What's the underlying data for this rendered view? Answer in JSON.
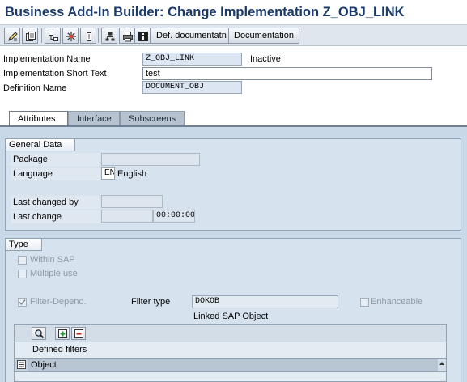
{
  "window": {
    "title": "Business Add-In Builder: Change Implementation Z_OBJ_LINK"
  },
  "toolbar": {
    "icons": [
      "edit-display-icon",
      "other-object-icon",
      "object-tree-icon",
      "activate-icon",
      "where-used-icon",
      "hierarchy-icon",
      "print-icon",
      "info-icon"
    ],
    "def_documentation_label": "Def. documentatn",
    "documentation_label": "Documentation"
  },
  "header": {
    "implementation_name": {
      "label": "Implementation Name",
      "value": "Z_OBJ_LINK",
      "status": "Inactive"
    },
    "short_text": {
      "label": "Implementation Short Text",
      "value": "test"
    },
    "definition_name": {
      "label": "Definition Name",
      "value": "DOCUMENT_OBJ"
    }
  },
  "tabs": [
    {
      "label": "Attributes",
      "active": true
    },
    {
      "label": "Interface",
      "active": false
    },
    {
      "label": "Subscreens",
      "active": false
    }
  ],
  "general_data": {
    "title": "General Data",
    "package": {
      "label": "Package",
      "value": ""
    },
    "language": {
      "label": "Language",
      "code": "EN",
      "name": "English"
    },
    "last_changed_by": {
      "label": "Last changed by",
      "value": ""
    },
    "last_change": {
      "label": "Last change",
      "date": "",
      "time": "00:00:00"
    }
  },
  "type_group": {
    "title": "Type",
    "within_sap": {
      "label": "Within SAP",
      "checked": false
    },
    "multiple_use": {
      "label": "Multiple use",
      "checked": false
    },
    "filter_depend": {
      "label": "Filter-Depend.",
      "checked": true
    },
    "filter_type": {
      "label": "Filter type",
      "value": "DOKOB",
      "description": "Linked SAP Object"
    },
    "enhanceable": {
      "label": "Enhanceable",
      "checked": false
    }
  },
  "defined_filters": {
    "toolbar_icons": [
      "search-icon",
      "insert-row-icon",
      "delete-row-icon"
    ],
    "caption": "Defined filters",
    "columns": [
      "Object"
    ]
  },
  "colors": {
    "title_text": "#1a3a6b",
    "tab_area_background": "#c8d8e6",
    "group_background": "#d6e2ee",
    "display_field": "#dbe6f2"
  }
}
